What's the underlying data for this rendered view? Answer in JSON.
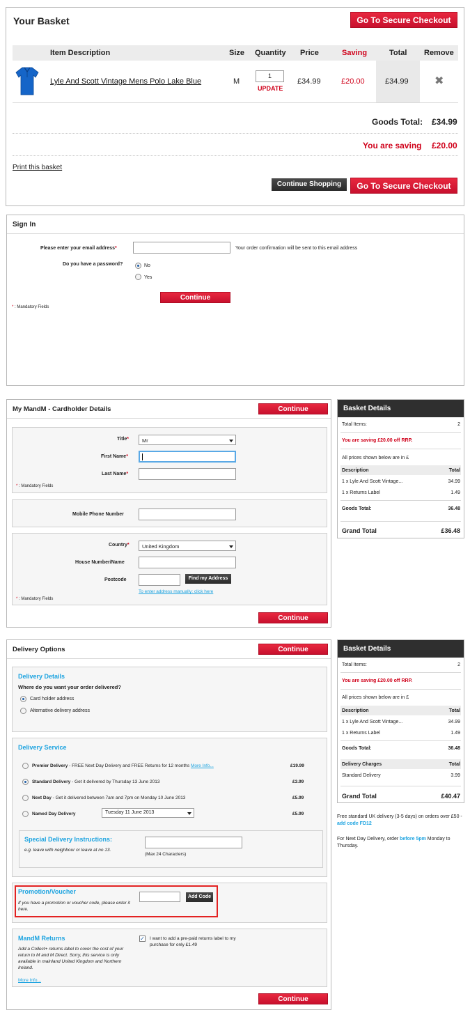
{
  "basket": {
    "title": "Your Basket",
    "checkout_label": "Go To Secure Checkout",
    "columns": [
      "Item Description",
      "Size",
      "Quantity",
      "Price",
      "Saving",
      "Total",
      "Remove"
    ],
    "item": {
      "name": "Lyle And Scott Vintage Mens Polo Lake Blue",
      "size": "M",
      "quantity": "1",
      "update": "UPDATE",
      "price": "£34.99",
      "saving": "£20.00",
      "total": "£34.99"
    },
    "goods_total_label": "Goods Total:",
    "goods_total": "£34.99",
    "saving_label": "You are saving",
    "saving_value": "£20.00",
    "print_label": "Print this basket",
    "continue_shopping": "Continue Shopping"
  },
  "signin": {
    "title": "Sign In",
    "email_label": "Please enter your email address",
    "email_hint": "Your order confirmation will be sent to this email address",
    "password_label": "Do you have a password?",
    "opt_no": "No",
    "opt_yes": "Yes",
    "continue": "Continue",
    "mandatory_star": "*",
    "mandatory": " : Mandatory Fields"
  },
  "cardholder": {
    "title": "My MandM - Cardholder Details",
    "continue": "Continue",
    "title_label": "Title",
    "title_value": "Mr",
    "first_name_label": "First Name",
    "last_name_label": "Last Name",
    "mandatory_star": "*",
    "mandatory": " : Mandatory Fields",
    "mobile_label": "Mobile Phone Number",
    "country_label": "Country",
    "country_value": "United Kingdom",
    "house_label": "House Number/Name",
    "postcode_label": "Postcode",
    "find_address": "Find my Address",
    "manual_link": "To enter address manually: click here",
    "mandatory2": " : Mandatory Fields"
  },
  "side1": {
    "title": "Basket Details",
    "total_items_label": "Total Items:",
    "total_items": "2",
    "saving_text": "You are saving £20.00 off RRP.",
    "prices_note": "All prices shown below are in £",
    "desc_head": "Description",
    "total_head": "Total",
    "rows": [
      {
        "desc": "1 x Lyle And Scott Vintage...",
        "total": "34.99"
      },
      {
        "desc": "1 x Returns Label",
        "total": "1.49"
      }
    ],
    "goods_total_label": "Goods Total:",
    "goods_total": "36.48",
    "grand_label": "Grand Total",
    "grand_total": "£36.48"
  },
  "delivery": {
    "title": "Delivery Options",
    "continue": "Continue",
    "details_head": "Delivery Details",
    "where_label": "Where do you want your order delivered?",
    "opt_card": "Card holder address",
    "opt_alt": "Alternative delivery address",
    "service_head": "Delivery Service",
    "services": [
      {
        "name": "Premier Delivery",
        "desc": " - FREE Next Day Delivery and FREE Returns for 12 months ",
        "link": "More Info...",
        "price": "£19.99"
      },
      {
        "name": "Standard Delivery",
        "desc": " - Get it delivered by Thursday 13 June 2013",
        "price": "£3.99"
      },
      {
        "name": "Next Day",
        "desc": " - Get it delivered between 7am and 7pm on Monday 10 June 2013",
        "price": "£5.99"
      },
      {
        "name": "Named Day Delivery",
        "date": "Tuesday 11 June 2013",
        "price": "£5.99"
      }
    ],
    "special_head": "Special Delivery Instructions:",
    "special_hint": "e.g. leave with neighbour or leave at no 13.",
    "max_chars": "(Max 24 Characters)",
    "promo_head": "Promotion/Voucher",
    "promo_hint": "If you have a promotion or voucher code, please enter it here.",
    "add_code": "Add Code",
    "returns_head": "MandM Returns",
    "returns_desc": "Add a Collect+ returns label to cover the cost of your return to M and M Direct. Sorry, this service is only available in mainland United Kingdom and Northern Ireland.",
    "returns_link": "More Info...",
    "returns_check": "I want to add a pre-paid returns label to my purchase for only £1.49"
  },
  "side2": {
    "title": "Basket Details",
    "total_items_label": "Total Items:",
    "total_items": "2",
    "saving_text": "You are saving £20.00 off RRP.",
    "prices_note": "All prices shown below are in £",
    "desc_head": "Description",
    "total_head": "Total",
    "rows": [
      {
        "desc": "1 x Lyle And Scott Vintage...",
        "total": "34.99"
      },
      {
        "desc": "1 x Returns Label",
        "total": "1.49"
      }
    ],
    "goods_total_label": "Goods Total:",
    "goods_total": "36.48",
    "charges_head": "Delivery Charges",
    "charges_total_head": "Total",
    "charges_row": "Standard Delivery",
    "charges_value": "3.99",
    "grand_label": "Grand Total",
    "grand_total": "£40.47",
    "free_note_pre": "Free standard UK delivery (3-5 days) on orders over £50 - ",
    "free_note_code": "add code FD12",
    "next_note_pre": "For Next Day Delivery, order ",
    "next_note_time": "before 5pm",
    "next_note_post": " Monday to Thursday."
  },
  "colors": {
    "accent_red": "#d0021b",
    "link_blue": "#1ba3e0",
    "dark": "#2f2f2f"
  }
}
